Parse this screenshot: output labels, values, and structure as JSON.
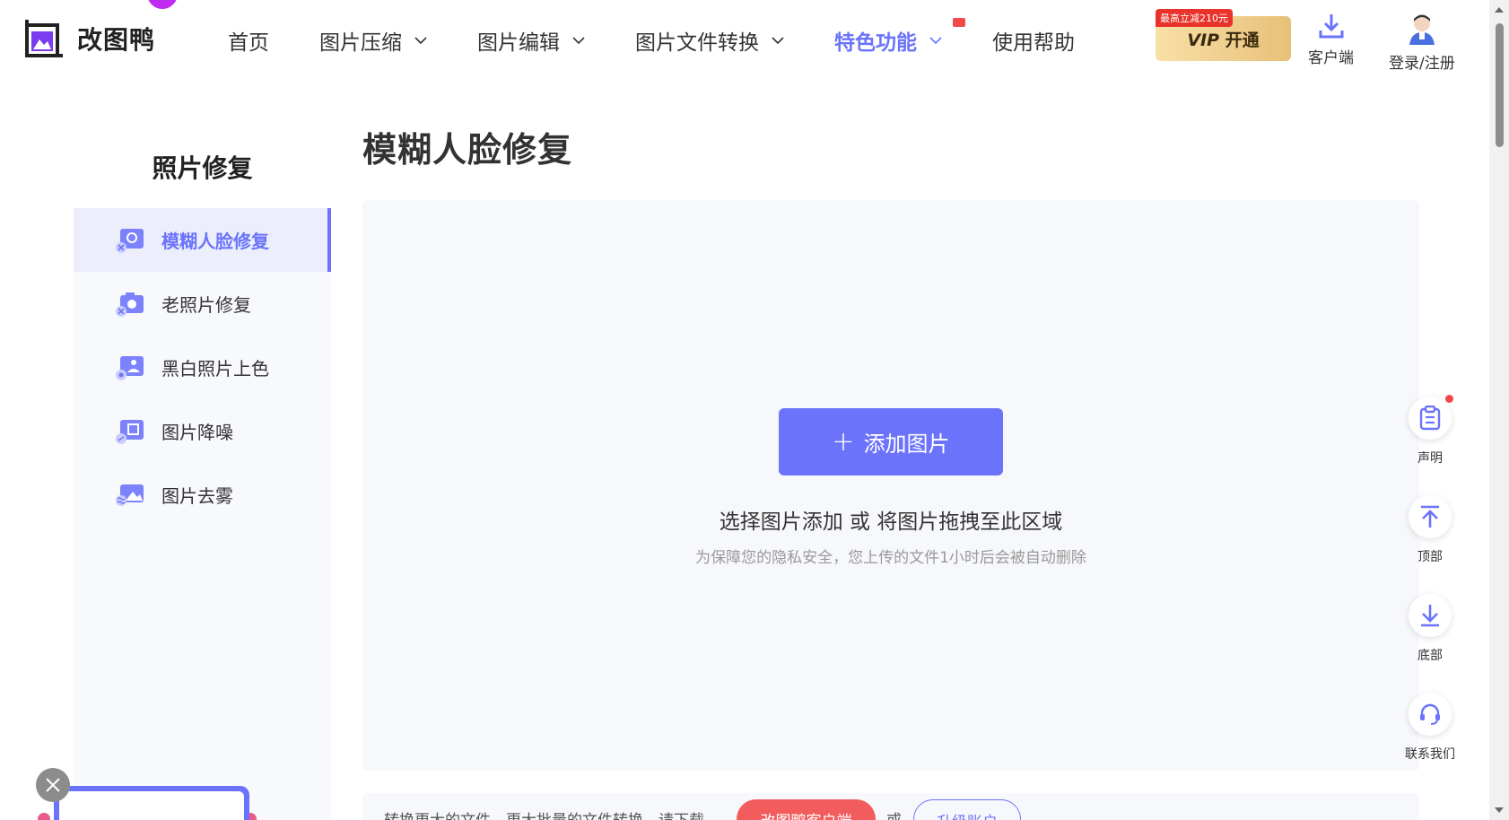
{
  "brand": {
    "name": "改图鸭"
  },
  "nav": {
    "items": [
      {
        "label": "首页",
        "dropdown": false
      },
      {
        "label": "图片压缩",
        "dropdown": true
      },
      {
        "label": "图片编辑",
        "dropdown": true
      },
      {
        "label": "图片文件转换",
        "dropdown": true
      },
      {
        "label": "特色功能",
        "dropdown": true,
        "active": true
      },
      {
        "label": "使用帮助",
        "dropdown": false
      }
    ]
  },
  "vip": {
    "tag": "最高立减210元",
    "label_vip": "VIP",
    "label_open": "开通"
  },
  "header_actions": {
    "client": "客户端",
    "login": "登录/注册"
  },
  "sidebar": {
    "title": "照片修复",
    "items": [
      {
        "label": "模糊人脸修复",
        "active": true
      },
      {
        "label": "老照片修复"
      },
      {
        "label": "黑白照片上色"
      },
      {
        "label": "图片降噪"
      },
      {
        "label": "图片去雾"
      }
    ]
  },
  "main": {
    "title": "模糊人脸修复",
    "add_button": "添加图片",
    "hint": "选择图片添加 或 将图片拖拽至此区域",
    "privacy": "为保障您的隐私安全，您上传的文件1小时后会被自动删除"
  },
  "bottom_bar": {
    "text": "转换更大的文件，更大批量的文件转换，请下载",
    "client_button": "改图鸭客户端",
    "or": "或",
    "upgrade_button": "升级账户"
  },
  "float": {
    "statement": "声明",
    "top": "顶部",
    "bottom": "底部",
    "contact": "联系我们"
  },
  "colors": {
    "accent": "#6b73fb",
    "red": "#f25c5c",
    "vip_gold": "#e8c078"
  }
}
